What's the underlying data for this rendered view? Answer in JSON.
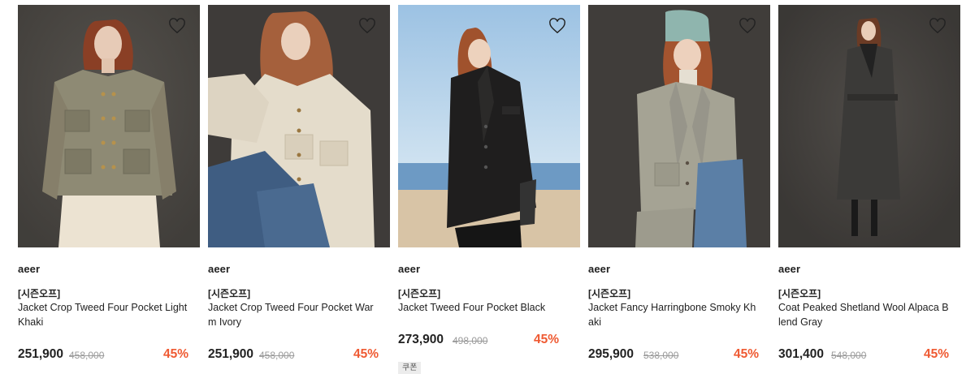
{
  "products": [
    {
      "brand": "aeer",
      "tag": "[시즌오프]",
      "name": "Jacket Crop Tweed Four Pocket Light Khaki",
      "price": "251,900",
      "original_price": "458,000",
      "discount": "45%",
      "coupon": null,
      "photo": {
        "bg": "#4a4743",
        "garment": "#8e8a74",
        "icon": "heart-outline-icon"
      }
    },
    {
      "brand": "aeer",
      "tag": "[시즌오프]",
      "name": "Jacket Crop Tweed Four Pocket Warm Ivory",
      "price": "251,900",
      "original_price": "458,000",
      "discount": "45%",
      "coupon": null,
      "photo": {
        "bg": "#3e3b39",
        "garment": "#e4dccb",
        "icon": "heart-outline-icon"
      }
    },
    {
      "brand": "aeer",
      "tag": "[시즌오프]",
      "name": "Jacket Tweed Four Pocket Black",
      "price": "273,900",
      "original_price": "498,000",
      "discount": "45%",
      "coupon": "쿠폰",
      "photo": {
        "bg": "#b7d3ea",
        "garment": "#1f1e1e",
        "icon": "heart-outline-icon"
      }
    },
    {
      "brand": "aeer",
      "tag": "[시즌오프]",
      "name": "Jacket Fancy Harringbone Smoky Khaki",
      "price": "295,900",
      "original_price": "538,000",
      "discount": "45%",
      "coupon": null,
      "photo": {
        "bg": "#403d3a",
        "garment": "#a5a394",
        "icon": "heart-outline-icon"
      }
    },
    {
      "brand": "aeer",
      "tag": "[시즌오프]",
      "name": "Coat Peaked Shetland Wool Alpaca Blend Gray",
      "price": "301,400",
      "original_price": "548,000",
      "discount": "45%",
      "coupon": null,
      "photo": {
        "bg": "#45423f",
        "garment": "#3b3a38",
        "icon": "heart-outline-icon"
      }
    }
  ],
  "colors": {
    "discount": "#ef5a32",
    "text": "#222222",
    "strike": "#9a9a9a"
  }
}
